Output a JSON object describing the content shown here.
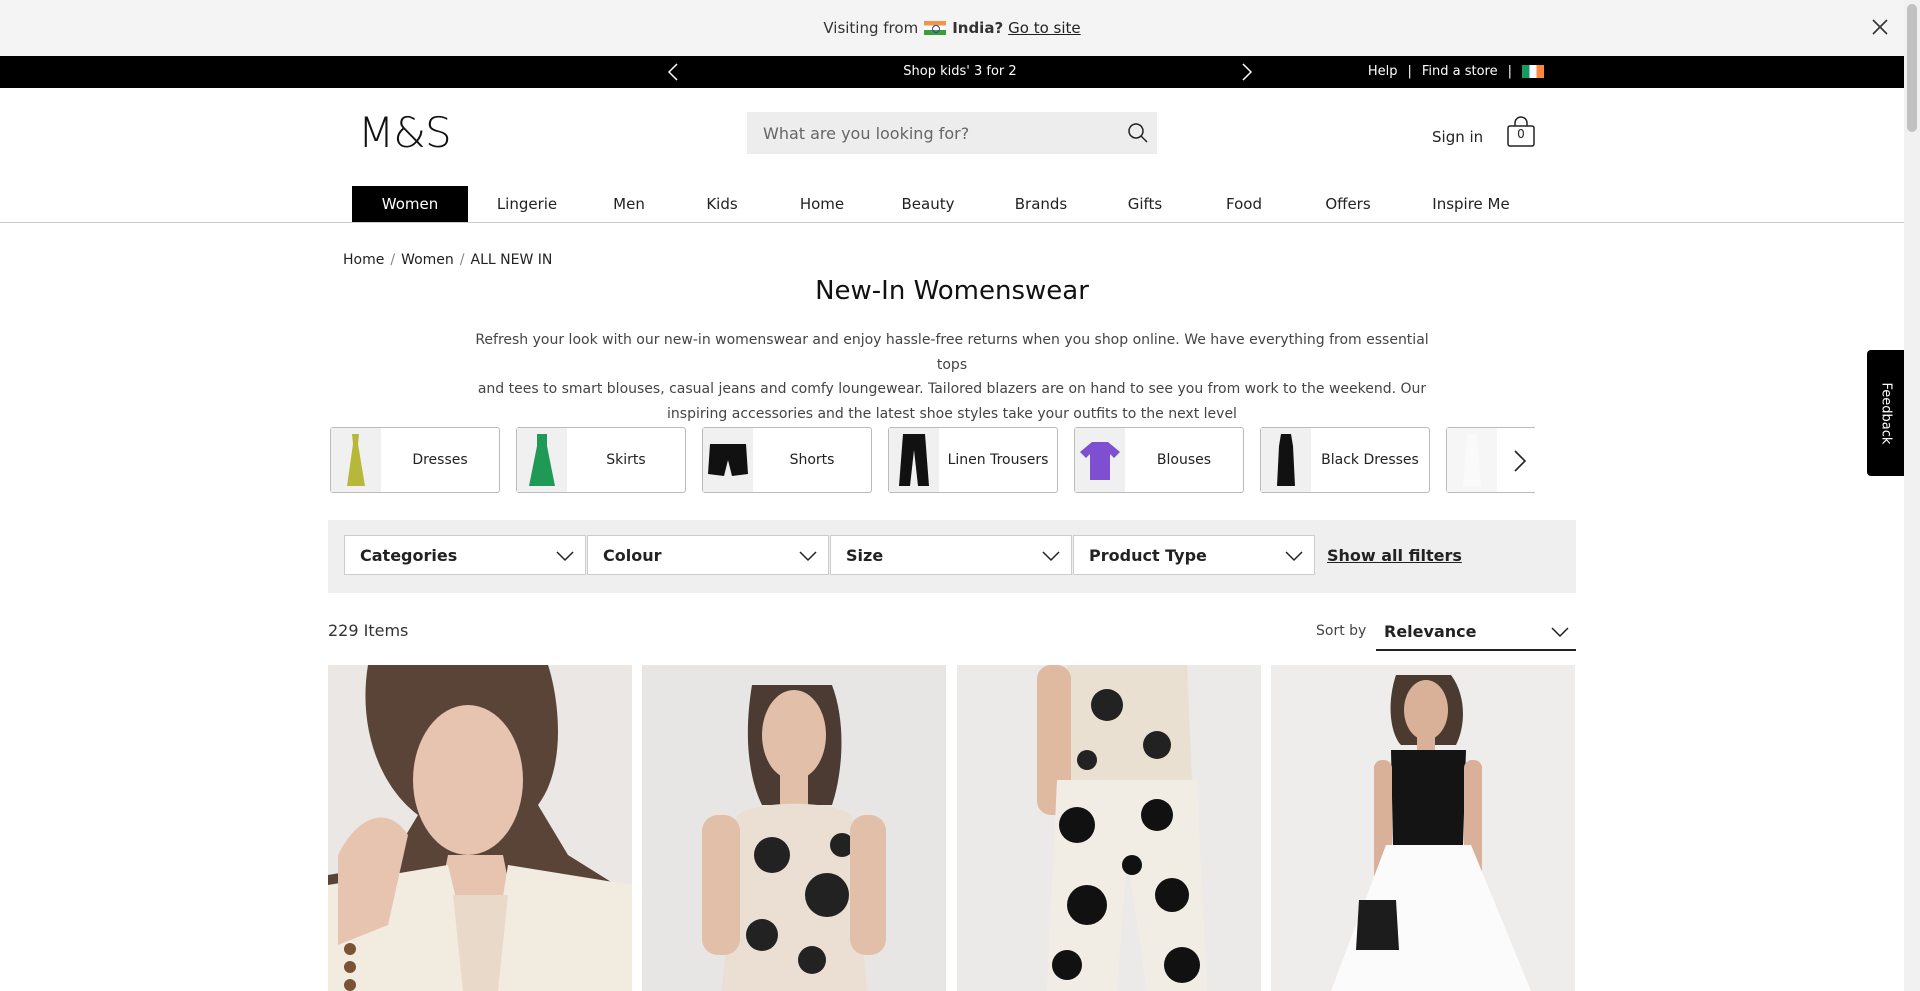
{
  "geo_banner": {
    "prefix": "Visiting from",
    "country": "India?",
    "link": "Go to site"
  },
  "promo": {
    "text": "Shop kids' 3 for 2",
    "help": "Help",
    "find_store": "Find a store",
    "separator": "|"
  },
  "header": {
    "logo": "M&S",
    "search_placeholder": "What are you looking for?",
    "sign_in": "Sign in",
    "bag_count": "0"
  },
  "nav": {
    "items": [
      "Women",
      "Lingerie",
      "Men",
      "Kids",
      "Home",
      "Beauty",
      "Brands",
      "Gifts",
      "Food",
      "Offers",
      "Inspire Me"
    ],
    "active": "Women"
  },
  "breadcrumb": [
    "Home",
    "Women",
    "ALL NEW IN"
  ],
  "page": {
    "title": "New-In Womenswear",
    "intro_1": "Refresh your look with our new-in womenswear and enjoy hassle-free returns when you shop online. We have everything from essential tops",
    "intro_2": "and tees to smart blouses, casual jeans and comfy loungewear. Tailored blazers are on hand to see you from work to the weekend. Our",
    "intro_3": "inspiring accessories and the latest shoe styles take your outfits to the next level"
  },
  "categories": [
    "Dresses",
    "Skirts",
    "Shorts",
    "Linen Trousers",
    "Blouses",
    "Black Dresses"
  ],
  "filters": {
    "selects": [
      "Categories",
      "Colour",
      "Size",
      "Product Type"
    ],
    "show_all": "Show all filters"
  },
  "results": {
    "count": "229 Items",
    "sort_label": "Sort by",
    "sort_value": "Relevance"
  },
  "feedback": "Feedback",
  "colors": {
    "accent": "#000000",
    "filter_panel": "#efefef",
    "search_bg": "#ededed"
  }
}
